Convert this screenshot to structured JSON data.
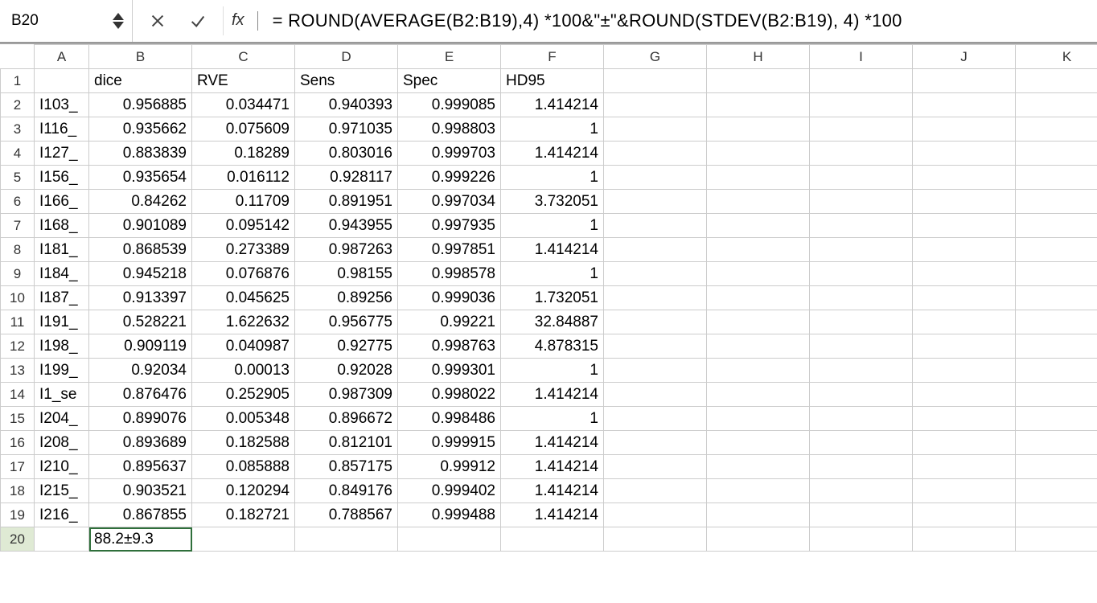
{
  "formula_bar": {
    "cell_ref": "B20",
    "fx_label": "fx",
    "formula": "= ROUND(AVERAGE(B2:B19),4) *100&\"±\"&ROUND(STDEV(B2:B19), 4) *100"
  },
  "columns_letters": [
    "A",
    "B",
    "C",
    "D",
    "E",
    "F",
    "G",
    "H",
    "I",
    "J",
    "K"
  ],
  "headers": {
    "b": "dice",
    "c": "RVE",
    "d": "Sens",
    "e": "Spec",
    "f": "HD95"
  },
  "rows": [
    {
      "n": 1
    },
    {
      "n": 2,
      "a": "I103_",
      "b": "0.956885",
      "c": "0.034471",
      "d": "0.940393",
      "e": "0.999085",
      "f": "1.414214"
    },
    {
      "n": 3,
      "a": "I116_",
      "b": "0.935662",
      "c": "0.075609",
      "d": "0.971035",
      "e": "0.998803",
      "f": "1"
    },
    {
      "n": 4,
      "a": "I127_",
      "b": "0.883839",
      "c": "0.18289",
      "d": "0.803016",
      "e": "0.999703",
      "f": "1.414214"
    },
    {
      "n": 5,
      "a": "I156_",
      "b": "0.935654",
      "c": "0.016112",
      "d": "0.928117",
      "e": "0.999226",
      "f": "1"
    },
    {
      "n": 6,
      "a": "I166_",
      "b": "0.84262",
      "c": "0.11709",
      "d": "0.891951",
      "e": "0.997034",
      "f": "3.732051"
    },
    {
      "n": 7,
      "a": "I168_",
      "b": "0.901089",
      "c": "0.095142",
      "d": "0.943955",
      "e": "0.997935",
      "f": "1"
    },
    {
      "n": 8,
      "a": "I181_",
      "b": "0.868539",
      "c": "0.273389",
      "d": "0.987263",
      "e": "0.997851",
      "f": "1.414214"
    },
    {
      "n": 9,
      "a": "I184_",
      "b": "0.945218",
      "c": "0.076876",
      "d": "0.98155",
      "e": "0.998578",
      "f": "1"
    },
    {
      "n": 10,
      "a": "I187_",
      "b": "0.913397",
      "c": "0.045625",
      "d": "0.89256",
      "e": "0.999036",
      "f": "1.732051"
    },
    {
      "n": 11,
      "a": "I191_",
      "b": "0.528221",
      "c": "1.622632",
      "d": "0.956775",
      "e": "0.99221",
      "f": "32.84887"
    },
    {
      "n": 12,
      "a": "I198_",
      "b": "0.909119",
      "c": "0.040987",
      "d": "0.92775",
      "e": "0.998763",
      "f": "4.878315"
    },
    {
      "n": 13,
      "a": "I199_",
      "b": "0.92034",
      "c": "0.00013",
      "d": "0.92028",
      "e": "0.999301",
      "f": "1"
    },
    {
      "n": 14,
      "a": "I1_se",
      "b": "0.876476",
      "c": "0.252905",
      "d": "0.987309",
      "e": "0.998022",
      "f": "1.414214"
    },
    {
      "n": 15,
      "a": "I204_",
      "b": "0.899076",
      "c": "0.005348",
      "d": "0.896672",
      "e": "0.998486",
      "f": "1"
    },
    {
      "n": 16,
      "a": "I208_",
      "b": "0.893689",
      "c": "0.182588",
      "d": "0.812101",
      "e": "0.999915",
      "f": "1.414214"
    },
    {
      "n": 17,
      "a": "I210_",
      "b": "0.895637",
      "c": "0.085888",
      "d": "0.857175",
      "e": "0.99912",
      "f": "1.414214"
    },
    {
      "n": 18,
      "a": "I215_",
      "b": "0.903521",
      "c": "0.120294",
      "d": "0.849176",
      "e": "0.999402",
      "f": "1.414214"
    },
    {
      "n": 19,
      "a": "I216_",
      "b": "0.867855",
      "c": "0.182721",
      "d": "0.788567",
      "e": "0.999488",
      "f": "1.414214"
    },
    {
      "n": 20,
      "b_txt": "88.2±9.3"
    }
  ]
}
